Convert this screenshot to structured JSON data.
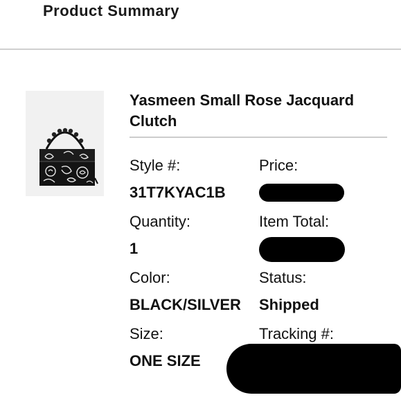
{
  "summary": {
    "title": "Product Summary"
  },
  "product": {
    "image_icon": "clutch-bag-image",
    "name": "Yasmeen Small Rose Jacquard Clutch",
    "style_label": "Style #:",
    "style_value": "31T7KYAC1B",
    "price_label": "Price:",
    "quantity_label": "Quantity:",
    "quantity_value": "1",
    "item_total_label": "Item Total:",
    "color_label": "Color:",
    "color_value": "BLACK/SILVER",
    "status_label": "Status:",
    "status_value": "Shipped",
    "size_label": "Size:",
    "size_value": "ONE SIZE",
    "tracking_label": "Tracking #:"
  }
}
